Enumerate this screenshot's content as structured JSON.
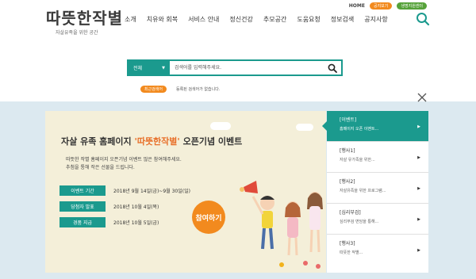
{
  "header": {
    "logo_title": "따뜻한작별",
    "logo_subtitle": "자살유족을 위한 공간",
    "top_links": {
      "home": "HOME",
      "pill1": "공지보기",
      "pill2": "생명지원센터"
    },
    "nav": [
      "소개",
      "치유와 회복",
      "서비스 안내",
      "정신건강",
      "추모공간",
      "도움요청",
      "정보검색",
      "공지사항"
    ],
    "colors": {
      "accent": "#1b9a8e",
      "orange": "#f28a1e"
    }
  },
  "search": {
    "category": "전체",
    "placeholder": "검색어를 입력해주세요.",
    "recent_label": "최근검색어",
    "recent_text": "등록된 검색어가 없습니다."
  },
  "banner": {
    "title_pre": "자살 유족 홈페이지 ",
    "title_highlight": "'따뜻한작별'",
    "title_post": " 오픈기념 이벤트",
    "desc_line1": "따뜻한 작별 홈페이지 오픈기념 이벤트 많은 참여해주세요.",
    "desc_line2": "추첨을 통해 작은 선물을 드립니다.",
    "info": [
      {
        "label": "이벤트 기간",
        "value": "2018년 9월 14일(금)~9월 30일(일)"
      },
      {
        "label": "당첨자 발표",
        "value": "2018년 10월 4일(목)"
      },
      {
        "label": "경품 지급",
        "value": "2018년 10월 5일(금)"
      }
    ],
    "join_label": "참여하기"
  },
  "events": [
    {
      "cat": "[이벤트]",
      "title": "홈페이지 오픈 이벤트..."
    },
    {
      "cat": "[행사1]",
      "title": "자살 유가족을 위한..."
    },
    {
      "cat": "[행사2]",
      "title": "자살유족을 위한 프로그램..."
    },
    {
      "cat": "[심리부검]",
      "title": "심리부검 면담을 통해..."
    },
    {
      "cat": "[행사3]",
      "title": "따뜻한 작별..."
    }
  ]
}
